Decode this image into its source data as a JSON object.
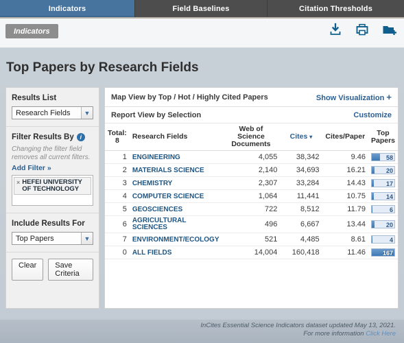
{
  "tabs": [
    {
      "label": "Indicators",
      "active": true
    },
    {
      "label": "Field Baselines",
      "active": false
    },
    {
      "label": "Citation Thresholds",
      "active": false
    }
  ],
  "toolbar": {
    "breadcrumb": "Indicators",
    "icons": [
      {
        "name": "download-icon",
        "title": "Download"
      },
      {
        "name": "print-icon",
        "title": "Print"
      },
      {
        "name": "add-to-folder-icon",
        "title": "Add to folder"
      }
    ]
  },
  "page": {
    "title": "Top Papers by Research Fields"
  },
  "sidebar": {
    "results_list": {
      "title": "Results List",
      "selected": "Research Fields"
    },
    "filter": {
      "title": "Filter Results By",
      "help_icon": "help-icon",
      "note": "Changing the filter field removes all current filters.",
      "add_filter": "Add Filter »",
      "chips": [
        {
          "label": "HEFEI UNIVERSITY OF TECHNOLOGY",
          "remove": "×"
        }
      ]
    },
    "include": {
      "title": "Include Results For",
      "selected": "Top Papers"
    },
    "buttons": {
      "clear": "Clear",
      "save": "Save Criteria"
    }
  },
  "main": {
    "map_view_label": "Map View by Top / Hot / Highly Cited Papers",
    "show_visualization": "Show Visualization",
    "show_visualization_plus": "+",
    "report_view_label": "Report View by Selection",
    "customize": "Customize",
    "total_label": "Total:",
    "total_value": "8",
    "columns": [
      "Research Fields",
      "Web of Science Documents",
      "Cites",
      "Cites/Paper",
      "Top Papers"
    ],
    "sorted_column": "Cites",
    "sort_caret": "▾"
  },
  "chart_data": {
    "type": "table",
    "title": "Top Papers by Research Fields",
    "columns": [
      "#",
      "Research Fields",
      "Web of Science Documents",
      "Cites",
      "Cites/Paper",
      "Top Papers"
    ],
    "bar_max": 167,
    "rows": [
      {
        "rank": "1",
        "field": "ENGINEERING",
        "documents": "4,055",
        "cites": "38,342",
        "cites_per_paper": "9.46",
        "top_papers": "58",
        "top_papers_value": 58
      },
      {
        "rank": "2",
        "field": "MATERIALS SCIENCE",
        "documents": "2,140",
        "cites": "34,693",
        "cites_per_paper": "16.21",
        "top_papers": "20",
        "top_papers_value": 20
      },
      {
        "rank": "3",
        "field": "CHEMISTRY",
        "documents": "2,307",
        "cites": "33,284",
        "cites_per_paper": "14.43",
        "top_papers": "17",
        "top_papers_value": 17
      },
      {
        "rank": "4",
        "field": "COMPUTER SCIENCE",
        "documents": "1,064",
        "cites": "11,441",
        "cites_per_paper": "10.75",
        "top_papers": "14",
        "top_papers_value": 14
      },
      {
        "rank": "5",
        "field": "GEOSCIENCES",
        "documents": "722",
        "cites": "8,512",
        "cites_per_paper": "11.79",
        "top_papers": "6",
        "top_papers_value": 6
      },
      {
        "rank": "6",
        "field": "AGRICULTURAL SCIENCES",
        "documents": "496",
        "cites": "6,667",
        "cites_per_paper": "13.44",
        "top_papers": "20",
        "top_papers_value": 20
      },
      {
        "rank": "7",
        "field": "ENVIRONMENT/ECOLOGY",
        "documents": "521",
        "cites": "4,485",
        "cites_per_paper": "8.61",
        "top_papers": "4",
        "top_papers_value": 4
      },
      {
        "rank": "0",
        "field": "ALL FIELDS",
        "documents": "14,004",
        "cites": "160,418",
        "cites_per_paper": "11.46",
        "top_papers": "167",
        "top_papers_value": 167
      }
    ]
  },
  "footer": {
    "line1": "InCites Essential Science Indicators dataset updated May 13, 2021.",
    "line2_prefix": "For more information ",
    "line2_link": "Click Here"
  },
  "colors": {
    "active_tab": "#46749f",
    "tab_bar": "#4d4d4d",
    "link": "#2a5f93",
    "bar_fill": "#3c79b4",
    "bar_track": "#e4ecf7",
    "page_bg": "#c6ced6"
  }
}
